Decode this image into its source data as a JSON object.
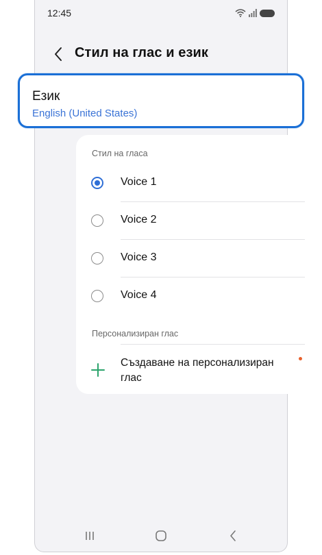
{
  "status_bar": {
    "time": "12:45"
  },
  "header": {
    "title": "Стил на глас и език"
  },
  "language": {
    "title": "Език",
    "value": "English (United States)"
  },
  "voice_style": {
    "section_label": "Стил на гласа",
    "options": [
      {
        "label": "Voice 1",
        "selected": true
      },
      {
        "label": "Voice 2",
        "selected": false
      },
      {
        "label": "Voice 3",
        "selected": false
      },
      {
        "label": "Voice 4",
        "selected": false
      }
    ]
  },
  "personalized": {
    "section_label": "Персонализиран глас",
    "create_label": "Създаване на персонализиран глас"
  },
  "colors": {
    "accent": "#2f6fd6",
    "highlight": "#1a6fd6",
    "plus": "#2aa36b",
    "badge": "#e8602c"
  },
  "icons": [
    "wifi-icon",
    "signal-icon",
    "battery-icon",
    "back-arrow-icon",
    "plus-icon",
    "recents-icon",
    "home-icon",
    "nav-back-icon"
  ]
}
